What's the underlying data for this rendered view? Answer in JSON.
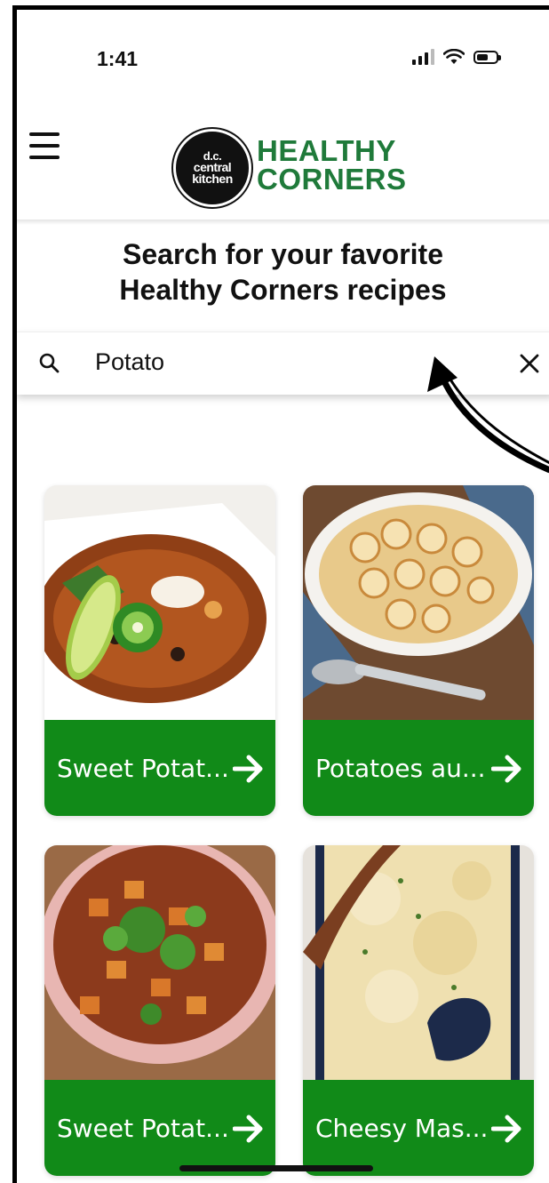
{
  "status_bar": {
    "time": "1:41",
    "battery_level": 0.6
  },
  "header": {
    "logo_lines": [
      "d.c.",
      "central",
      "kitchen"
    ],
    "brand_line1": "HEALTHY",
    "brand_line2": "CORNERS",
    "brand_color": "#1f7a3a"
  },
  "search": {
    "heading_line1": "Search for your favorite",
    "heading_line2": "Healthy Corners recipes",
    "value": "Potato"
  },
  "recipes": [
    {
      "title": "Sweet Potat...",
      "photo": "sweet-potato-soup"
    },
    {
      "title": "Potatoes au...",
      "photo": "potatoes-au-gratin"
    },
    {
      "title": "Sweet Potat...",
      "photo": "sweet-potato-hash"
    },
    {
      "title": "Cheesy Mas...",
      "photo": "cheesy-mashed-potatoes"
    }
  ],
  "colors": {
    "card_label": "#118a18",
    "accent_green": "#1f7a3a"
  }
}
